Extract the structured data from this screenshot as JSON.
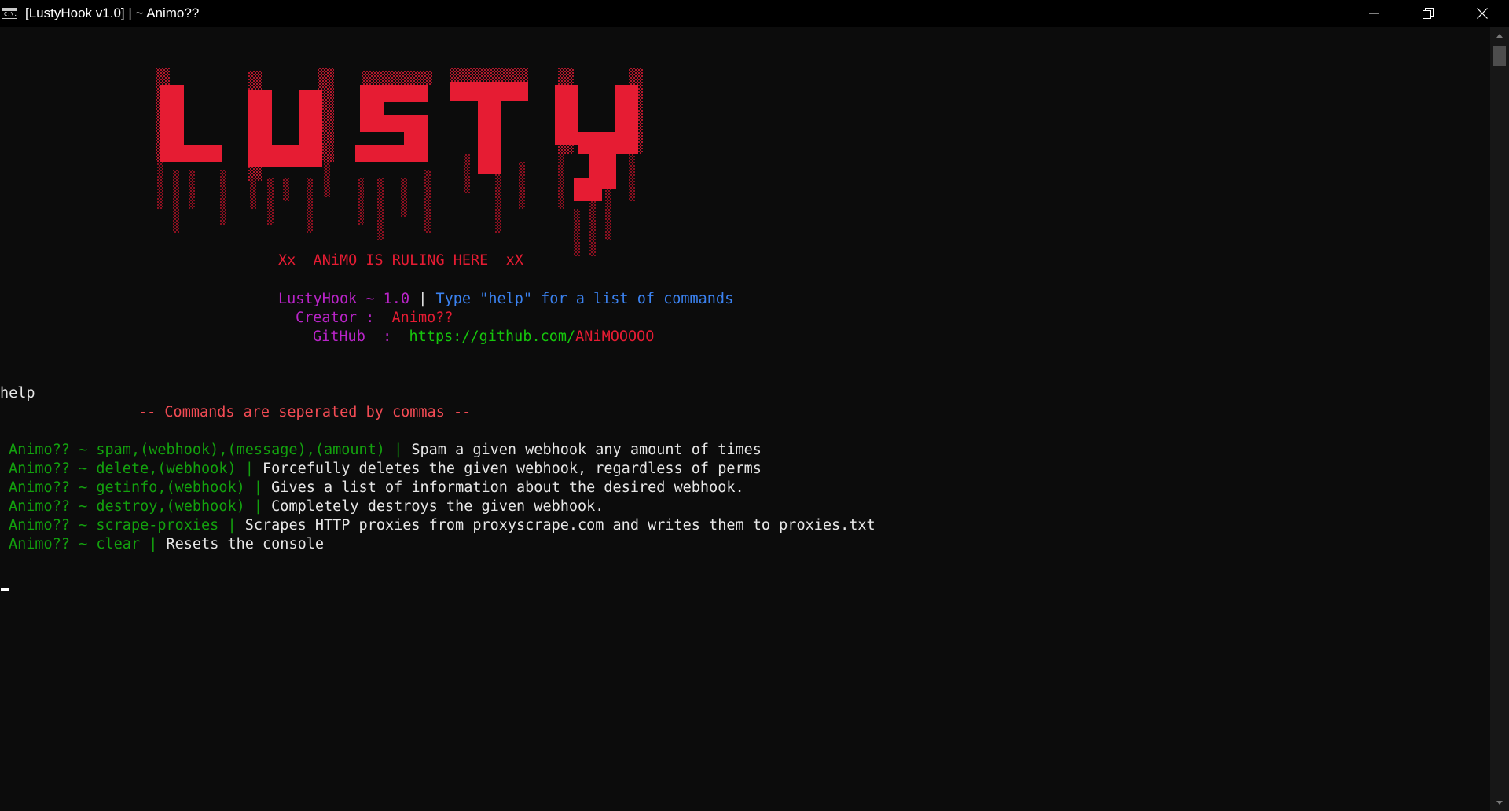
{
  "window": {
    "icon_text": "C:\\.",
    "title": "[LustyHook v1.0] | ~ Animo??",
    "minimize_icon": "minimize-icon",
    "restore_icon": "restore-icon",
    "close_icon": "close-icon"
  },
  "logo": {
    "text": "LUSTY",
    "color": "#e61c33"
  },
  "banner": {
    "ruling": "Xx  ANiMO IS RULING HERE  xX",
    "version_label": "LustyHook",
    "version_sep": " ~ ",
    "version": "1.0",
    "pipe": " | ",
    "help_hint": "Type \"help\" for a list of commands",
    "creator_label": "Creator :",
    "creator_value": "Animo??",
    "github_label": "GitHub  :",
    "github_url_prefix": "https://github.com/",
    "github_user": "ANiMOOOOO"
  },
  "session": {
    "input_command": "help",
    "commands_header": "-- Commands are seperated by commas --",
    "commands": [
      {
        "prompt": "Animo?? ~ ",
        "syntax": "spam,(webhook),(message),(amount)",
        "sep": " | ",
        "description": "Spam a given webhook any amount of times"
      },
      {
        "prompt": "Animo?? ~ ",
        "syntax": "delete,(webhook)",
        "sep": " | ",
        "description": "Forcefully deletes the given webhook, regardless of perms"
      },
      {
        "prompt": "Animo?? ~ ",
        "syntax": "getinfo,(webhook)",
        "sep": " | ",
        "description": "Gives a list of information about the desired webhook."
      },
      {
        "prompt": "Animo?? ~ ",
        "syntax": "destroy,(webhook)",
        "sep": " | ",
        "description": "Completely destroys the given webhook."
      },
      {
        "prompt": "Animo?? ~ ",
        "syntax": "scrape-proxies",
        "sep": " | ",
        "description": "Scrapes HTTP proxies from proxyscrape.com and writes them to proxies.txt"
      },
      {
        "prompt": "Animo?? ~ ",
        "syntax": "clear",
        "sep": " | ",
        "description": "Resets the console"
      }
    ]
  }
}
